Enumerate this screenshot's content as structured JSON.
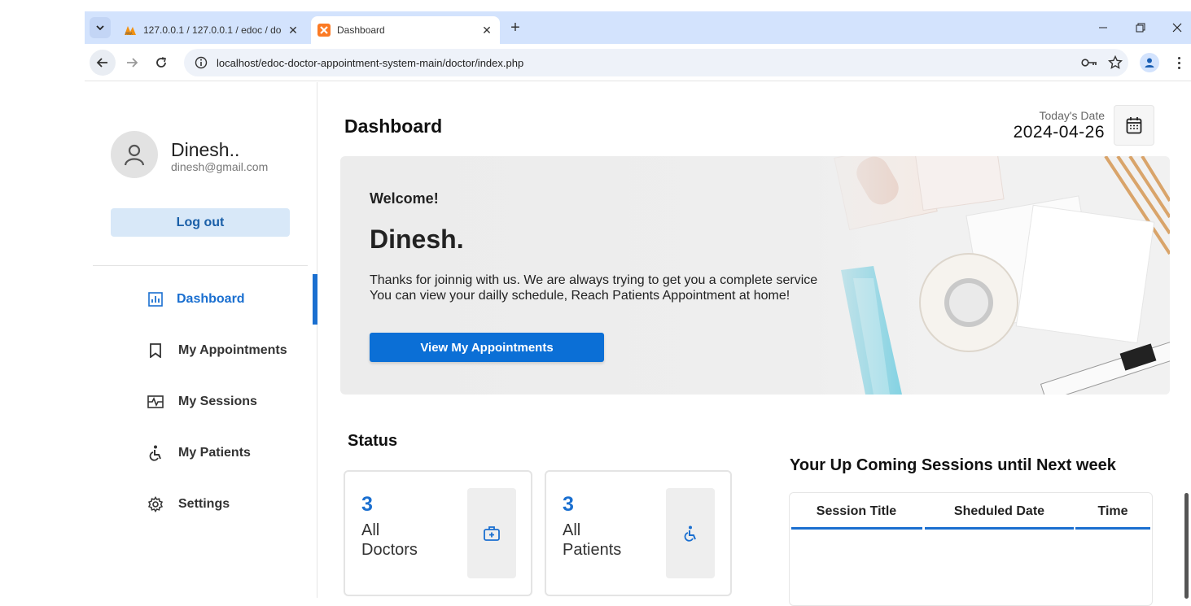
{
  "browser": {
    "tabs": [
      {
        "title": "127.0.0.1 / 127.0.0.1 / edoc / do",
        "active": false
      },
      {
        "title": "Dashboard",
        "active": true
      }
    ],
    "url": "localhost/edoc-doctor-appointment-system-main/doctor/index.php"
  },
  "sidebar": {
    "user_name": "Dinesh..",
    "user_email": "dinesh@gmail.com",
    "logout_label": "Log out",
    "items": [
      {
        "label": "Dashboard",
        "icon": "dashboard-icon",
        "active": true
      },
      {
        "label": "My Appointments",
        "icon": "bookmark-icon",
        "active": false
      },
      {
        "label": "My Sessions",
        "icon": "sessions-icon",
        "active": false
      },
      {
        "label": "My Patients",
        "icon": "wheelchair-icon",
        "active": false
      },
      {
        "label": "Settings",
        "icon": "gear-icon",
        "active": false
      }
    ]
  },
  "header": {
    "title": "Dashboard",
    "date_label": "Today's Date",
    "date_value": "2024-04-26"
  },
  "banner": {
    "welcome": "Welcome!",
    "name": "Dinesh.",
    "line1": "Thanks for joinnig with us. We are always trying to get you a complete service",
    "line2": "You can view your dailly schedule, Reach Patients Appointment at home!",
    "cta_label": "View My Appointments"
  },
  "status": {
    "title": "Status",
    "cards": [
      {
        "count": "3",
        "label_line1": "All",
        "label_line2": "Doctors",
        "icon": "doctor-bag-icon"
      },
      {
        "count": "3",
        "label_line1": "All",
        "label_line2": "Patients",
        "icon": "wheelchair-icon"
      }
    ]
  },
  "upcoming": {
    "title": "Your Up Coming Sessions until Next week",
    "columns": [
      "Session Title",
      "Sheduled Date",
      "Time"
    ]
  },
  "colors": {
    "accent": "#1a6fd0",
    "button": "#0b6fd6",
    "logout_bg": "#d8e8f8",
    "tabstrip": "#d3e3fd"
  }
}
